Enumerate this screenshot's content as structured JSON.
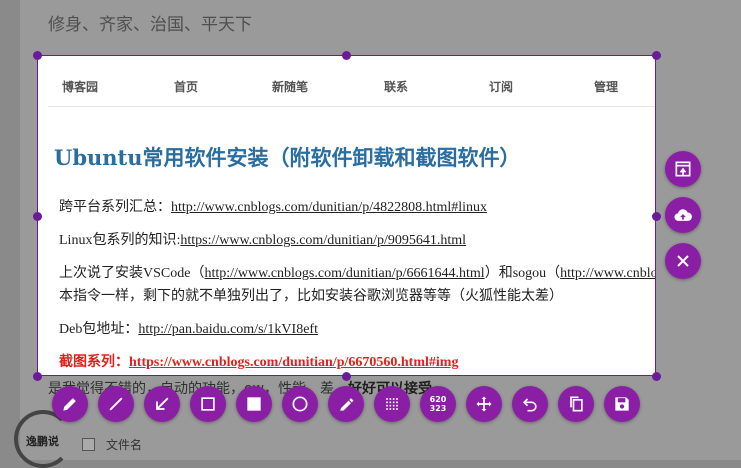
{
  "background": {
    "motto": "修身、齐家、治国、平天下",
    "under_text": "是我觉得不错的，自动的功能，ow，性能，差，",
    "under_bold": "好好可以接受",
    "filename_label": "文件名",
    "logo_text": "逸鹏说"
  },
  "nav": {
    "items": [
      "博客园",
      "首页",
      "新随笔",
      "联系",
      "订阅",
      "管理"
    ]
  },
  "article": {
    "title": "Ubuntu常用软件安装（附软件卸载和截图软件）",
    "line1_label": "跨平台系列汇总：",
    "line1_link": "http://www.cnblogs.com/dunitian/p/4822808.html#linux",
    "line2_label": "Linux包系列的知识:",
    "line2_link": "https://www.cnblogs.com/dunitian/p/9095641.html",
    "line3_prefix": "上次说了安装VSCode（",
    "line3_link1": "http://www.cnblogs.com/dunitian/p/6661644.html",
    "line3_mid": "）和sogou（",
    "line3_link2": "http://www.cnblogs.com/dunitian",
    "line4": "本指令一样，剩下的就不单独列出了，比如安装谷歌浏览器等等（火狐性能太差）",
    "line5_label": "Deb包地址：",
    "line5_link": "http://pan.baidu.com/s/1kVI8eft",
    "line6_label": "截图系列：",
    "line6_link": "https://www.cnblogs.com/dunitian/p/6670560.html#img"
  },
  "selection_size": {
    "width": "620",
    "height": "323"
  },
  "side_buttons": [
    "open-window-icon",
    "upload-cloud-icon",
    "close-icon"
  ],
  "toolbar": [
    "pencil-icon",
    "line-icon",
    "arrow-icon",
    "rectangle-icon",
    "filled-rectangle-icon",
    "circle-icon",
    "marker-icon",
    "pixelate-icon",
    "size-indicator",
    "move-icon",
    "undo-icon",
    "copy-icon",
    "save-icon"
  ],
  "colors": {
    "accent": "#8a1fa6",
    "selection_border": "#6a1b9a",
    "title": "#2a6ea1",
    "red_text": "#e0211f"
  }
}
